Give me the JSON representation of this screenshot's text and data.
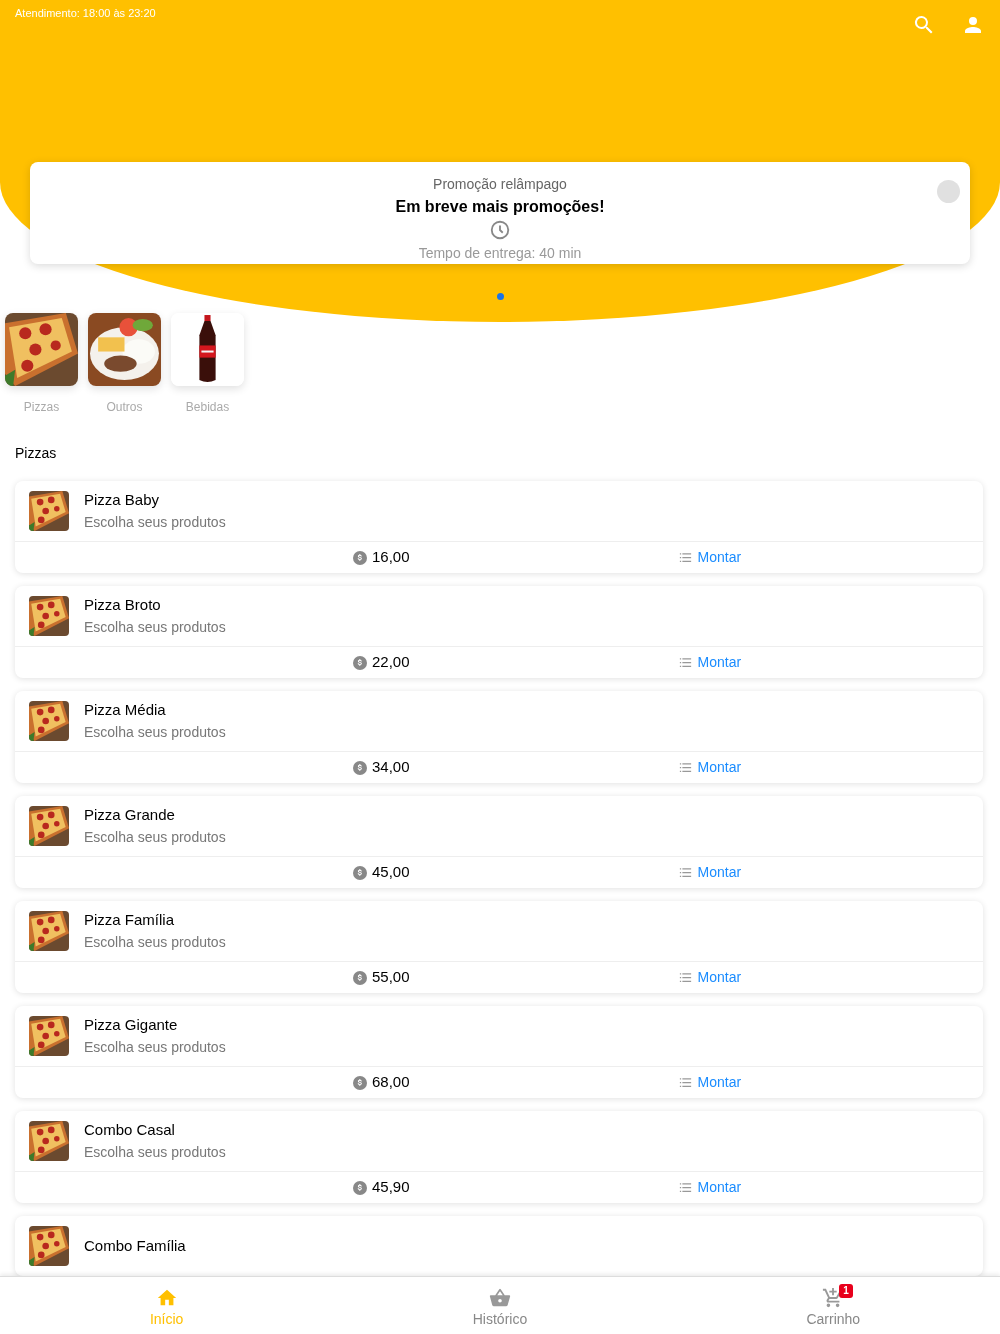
{
  "header": {
    "hours": "Atendimento: 18:00 às 23:20"
  },
  "promo": {
    "label": "Promoção relâmpago",
    "title": "Em breve mais promoções!",
    "delivery": "Tempo de entrega: 40 min"
  },
  "carousel_dots": [
    {
      "selected": true
    }
  ],
  "categories": [
    {
      "label": "Pizzas",
      "kind": "pizza"
    },
    {
      "label": "Outros",
      "kind": "plate"
    },
    {
      "label": "Bebidas",
      "kind": "bottle"
    }
  ],
  "section_title": "Pizzas",
  "products": [
    {
      "name": "Pizza Baby",
      "subtitle": "Escolha seus produtos",
      "price": "16,00",
      "action": "Montar"
    },
    {
      "name": "Pizza Broto",
      "subtitle": "Escolha seus produtos",
      "price": "22,00",
      "action": "Montar"
    },
    {
      "name": "Pizza Média",
      "subtitle": "Escolha seus produtos",
      "price": "34,00",
      "action": "Montar"
    },
    {
      "name": "Pizza Grande",
      "subtitle": "Escolha seus produtos",
      "price": "45,00",
      "action": "Montar"
    },
    {
      "name": "Pizza Família",
      "subtitle": "Escolha seus produtos",
      "price": "55,00",
      "action": "Montar"
    },
    {
      "name": "Pizza Gigante",
      "subtitle": "Escolha seus produtos",
      "price": "68,00",
      "action": "Montar"
    },
    {
      "name": "Combo Casal",
      "subtitle": "Escolha seus produtos",
      "price": "45,90",
      "action": "Montar"
    },
    {
      "name": "Combo Família"
    }
  ],
  "nav": [
    {
      "label": "Início",
      "kind": "home",
      "selected": true
    },
    {
      "label": "Histórico",
      "kind": "basket",
      "selected": false
    },
    {
      "label": "Carrinho",
      "kind": "cart",
      "selected": false,
      "badge": "1"
    }
  ]
}
